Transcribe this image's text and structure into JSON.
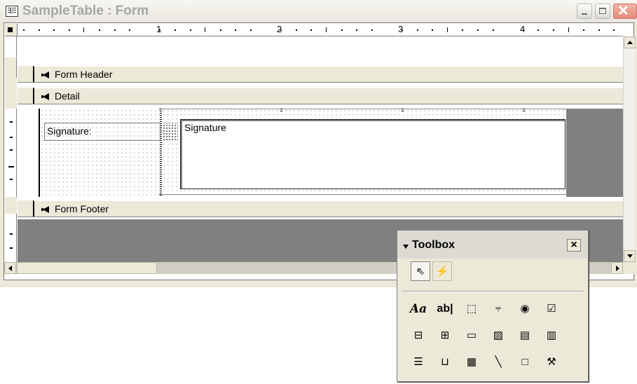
{
  "window": {
    "title": "SampleTable : Form",
    "close_glyph": "✕"
  },
  "ruler": {
    "numbers": [
      "1",
      "2",
      "3",
      "4"
    ]
  },
  "sections": {
    "form_header": "Form Header",
    "detail": "Detail",
    "form_footer": "Form Footer"
  },
  "controls": {
    "signature_label": "Signature:",
    "signature_value": "Signature"
  },
  "toolbox": {
    "title": "Toolbox",
    "close": "×",
    "tools": [
      {
        "name": "select-objects-icon",
        "glyph": "⇖"
      },
      {
        "name": "control-wizards-icon",
        "glyph": "⚡"
      },
      {
        "name": "label-tool-icon",
        "glyph": "Aa"
      },
      {
        "name": "text-box-tool-icon",
        "glyph": "ab|"
      },
      {
        "name": "option-group-tool-icon",
        "glyph": "⬚"
      },
      {
        "name": "toggle-button-tool-icon",
        "glyph": "⫧"
      },
      {
        "name": "option-button-tool-icon",
        "glyph": "◉"
      },
      {
        "name": "check-box-tool-icon",
        "glyph": "☑"
      },
      {
        "name": "combo-box-tool-icon",
        "glyph": "⊟"
      },
      {
        "name": "list-box-tool-icon",
        "glyph": "⊞"
      },
      {
        "name": "command-button-tool-icon",
        "glyph": "▭"
      },
      {
        "name": "image-tool-icon",
        "glyph": "▨"
      },
      {
        "name": "unbound-object-frame-tool-icon",
        "glyph": "▤"
      },
      {
        "name": "bound-object-frame-tool-icon",
        "glyph": "▥"
      },
      {
        "name": "page-break-tool-icon",
        "glyph": "☰"
      },
      {
        "name": "tab-control-tool-icon",
        "glyph": "⊔"
      },
      {
        "name": "subform-tool-icon",
        "glyph": "▦"
      },
      {
        "name": "line-tool-icon",
        "glyph": "╲"
      },
      {
        "name": "rectangle-tool-icon",
        "glyph": "□"
      },
      {
        "name": "more-controls-tool-icon",
        "glyph": "⚒"
      }
    ]
  },
  "colors": {
    "window_face": "#ece9d8",
    "dark_area": "#808080",
    "close_button": "#e88a7c"
  }
}
